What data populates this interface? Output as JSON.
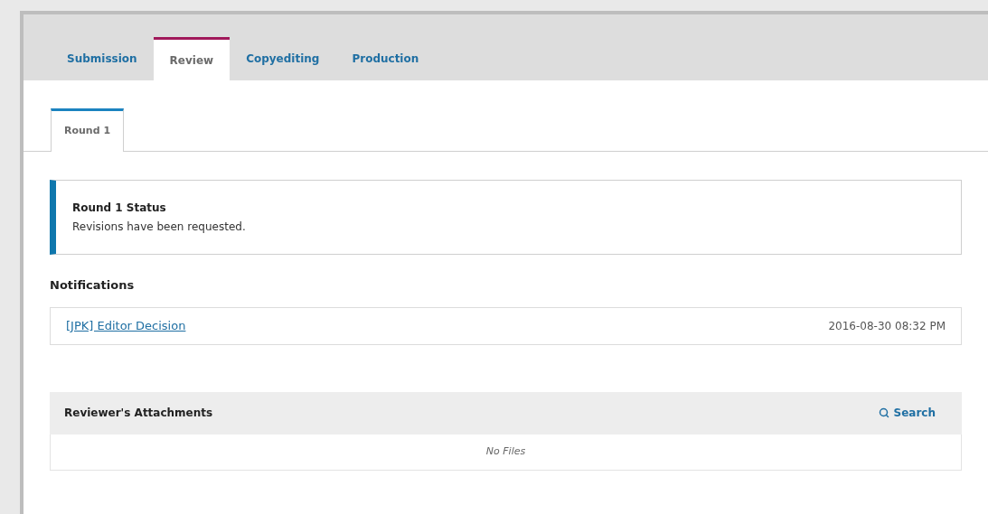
{
  "tabs": [
    {
      "label": "Submission",
      "selected": false
    },
    {
      "label": "Review",
      "selected": true
    },
    {
      "label": "Copyediting",
      "selected": false
    },
    {
      "label": "Production",
      "selected": false
    }
  ],
  "round_tabs": [
    {
      "label": "Round 1",
      "selected": true
    }
  ],
  "status": {
    "title": "Round 1 Status",
    "message": "Revisions have been requested."
  },
  "notifications": {
    "heading": "Notifications",
    "items": [
      {
        "link": "[JPK] Editor Decision",
        "date": "2016-08-30 08:32 PM"
      }
    ]
  },
  "attachments": {
    "title": "Reviewer's Attachments",
    "search": "Search",
    "empty": "No Files"
  }
}
